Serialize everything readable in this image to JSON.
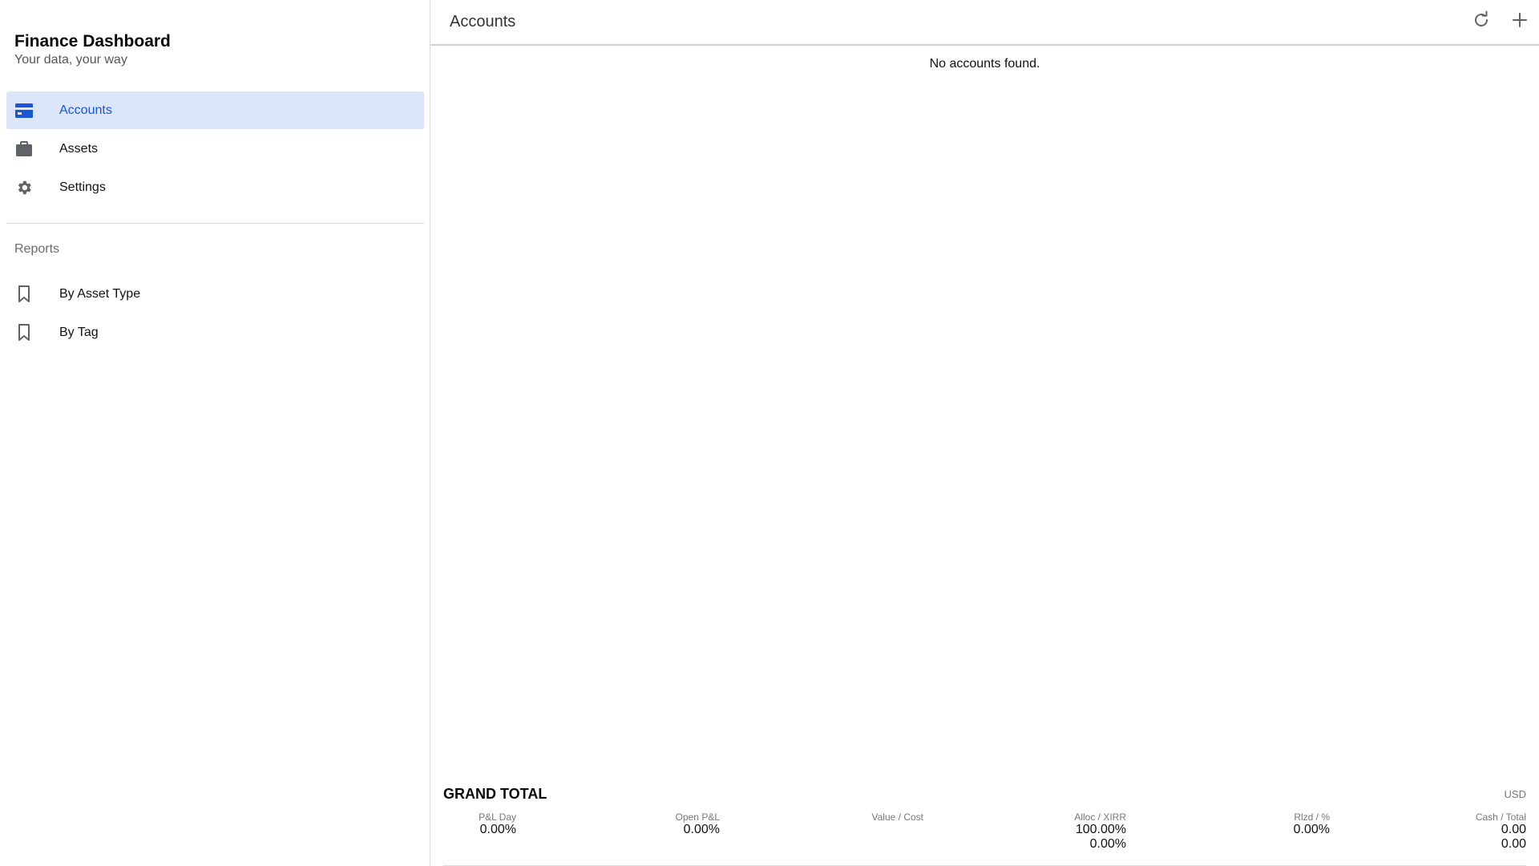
{
  "app": {
    "title": "Finance Dashboard",
    "subtitle": "Your data, your way"
  },
  "sidebar": {
    "items": [
      {
        "label": "Accounts",
        "icon": "credit-card-icon",
        "active": true
      },
      {
        "label": "Assets",
        "icon": "briefcase-icon",
        "active": false
      },
      {
        "label": "Settings",
        "icon": "gear-icon",
        "active": false
      }
    ],
    "section_label": "Reports",
    "reports": [
      {
        "label": "By Asset Type",
        "icon": "bookmark-icon"
      },
      {
        "label": "By Tag",
        "icon": "bookmark-icon"
      }
    ]
  },
  "main": {
    "title": "Accounts",
    "actions": [
      {
        "icon": "refresh-icon"
      },
      {
        "icon": "plus-icon"
      }
    ],
    "empty_message": "No accounts found."
  },
  "grand_total": {
    "title": "GRAND TOTAL",
    "currency": "USD",
    "columns": [
      {
        "header": "P&L Day",
        "values": [
          "0.00%"
        ]
      },
      {
        "header": "Open P&L",
        "values": [
          "0.00%"
        ]
      },
      {
        "header": "Value / Cost",
        "values": []
      },
      {
        "header": "Alloc / XIRR",
        "values": [
          "100.00%",
          "0.00%"
        ]
      },
      {
        "header": "Rlzd / %",
        "values": [
          "0.00%"
        ]
      },
      {
        "header": "Cash / Total",
        "values": [
          "0.00",
          "0.00"
        ]
      }
    ]
  },
  "colors": {
    "accent": "#1a56d6",
    "active_bg": "#dbe6fb",
    "icon_gray": "#5f6368"
  }
}
